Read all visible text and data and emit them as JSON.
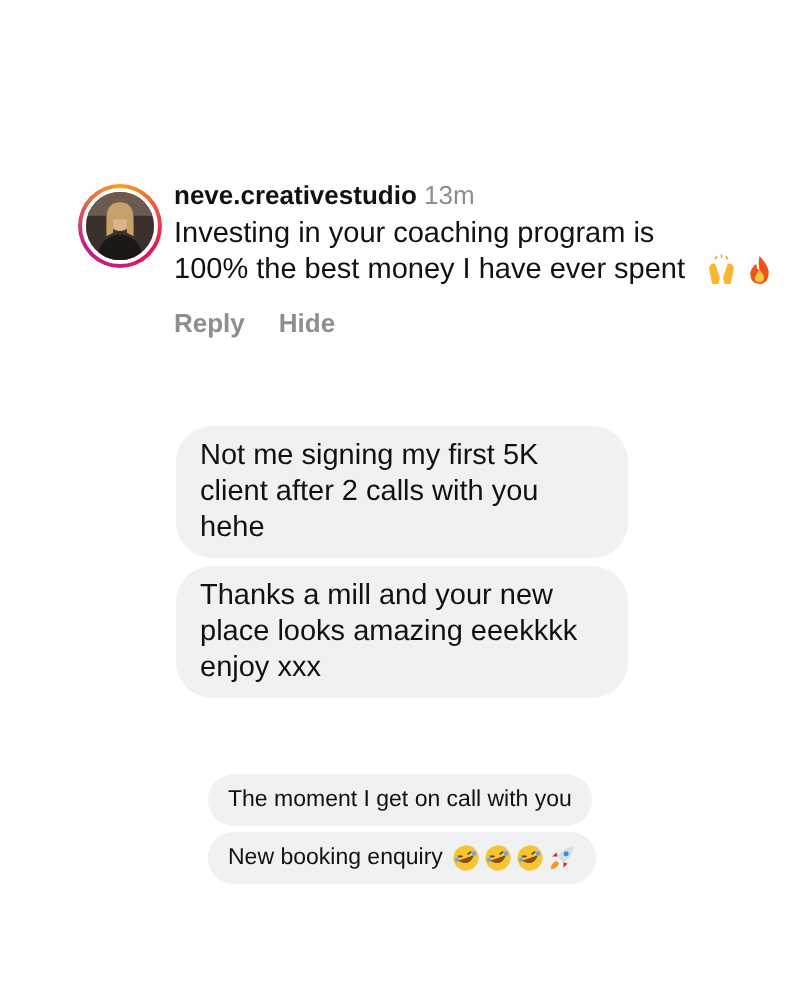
{
  "comment": {
    "username": "neve.creativestudio",
    "time": "13m",
    "text": "Investing in your coaching program is 100% the best money I have ever spent",
    "actions": [
      "Reply",
      "Hide"
    ]
  },
  "messages": [
    {
      "text": "Not me signing my first 5K client after 2 calls with you hehe"
    },
    {
      "text": "Thanks a mill and your new place looks amazing eeekkkk enjoy xxx"
    }
  ],
  "small_messages": [
    {
      "kind": "plain",
      "text": "The moment I get on call with you"
    },
    {
      "kind": "emoji",
      "text": "New booking enquiry"
    }
  ]
}
